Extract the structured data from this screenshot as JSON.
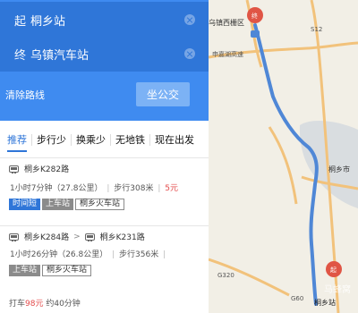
{
  "search": {
    "start_role": "起",
    "start_value": "桐乡站",
    "end_role": "终",
    "end_value": "乌镇汽车站",
    "clear_route": "清除路线",
    "bus_button": "坐公交"
  },
  "tabs": [
    "推荐",
    "步行少",
    "换乘少",
    "无地铁",
    "现在出发"
  ],
  "routes": [
    {
      "lines": [
        "桐乡K282路"
      ],
      "duration": "1小时7分钟",
      "distance": "（27.8公里）",
      "walk": "步行308米",
      "price": "5元",
      "chips": [
        {
          "text": "时间短",
          "style": "blue"
        },
        {
          "text": "上车站",
          "style": "gray"
        },
        {
          "text": "桐乡火车站",
          "style": "outline"
        }
      ]
    },
    {
      "lines": [
        "桐乡K284路",
        "桐乡K231路"
      ],
      "duration": "1小时26分钟",
      "distance": "（26.8公里）",
      "walk": "步行356米",
      "chips": [
        {
          "text": "上车站",
          "style": "gray"
        },
        {
          "text": "桐乡火车站",
          "style": "outline"
        }
      ]
    }
  ],
  "taxi": {
    "prefix": "打车",
    "price": "98元",
    "suffix": "约40分钟"
  },
  "map": {
    "labels": {
      "wuzhen_west": "乌镇西栅",
      "district": "区",
      "end_marker": "终",
      "start_marker": "起",
      "tongxiang_city": "桐乡市",
      "tongxiang_station": "桐乡站",
      "road_s12": "S12",
      "road_shenjia": "申嘉湖高速",
      "road_g320": "G320",
      "road_g60": "G60"
    },
    "watermark": "马蜂窝",
    "colors": {
      "route": "#4f87d6",
      "marker": "#e05545",
      "highway": "#f2c27b",
      "background": "#f2efe6"
    }
  }
}
